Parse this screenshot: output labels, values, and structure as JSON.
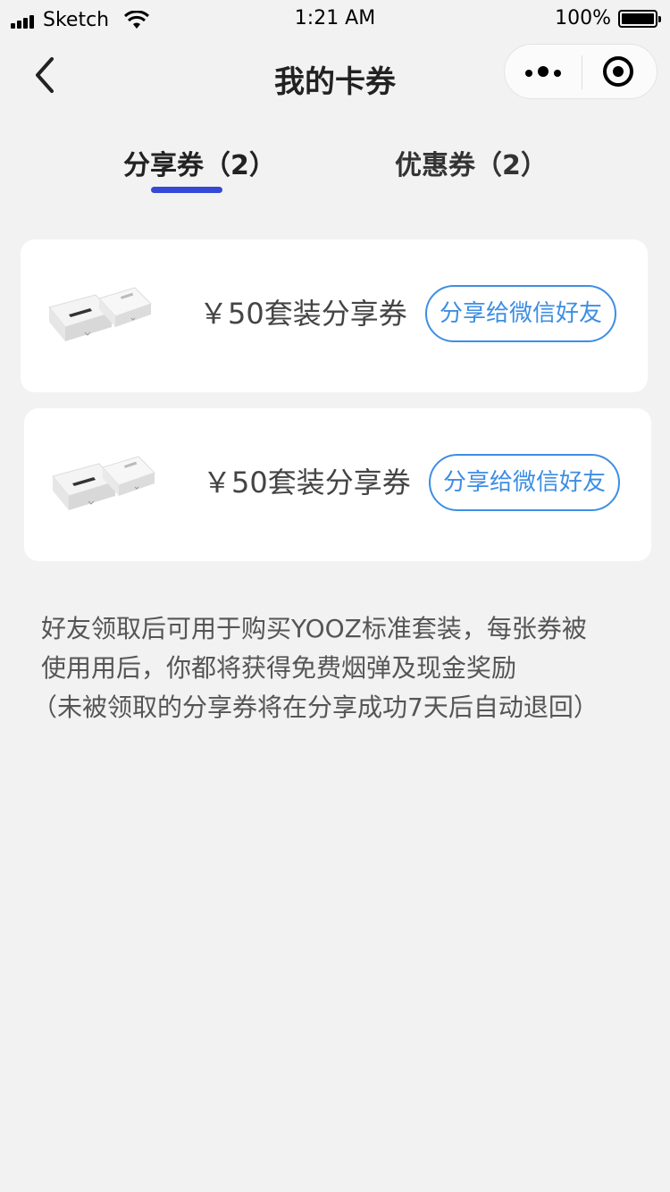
{
  "status_bar": {
    "carrier": "Sketch",
    "time": "1:21 AM",
    "battery": "100%"
  },
  "nav": {
    "title": "我的卡券"
  },
  "tabs": [
    {
      "label": "分享券（2）",
      "active": true
    },
    {
      "label": "优惠券（2）",
      "active": false
    }
  ],
  "colors": {
    "accent": "#3548d6",
    "button": "#3d8ee3",
    "background": "#f2f2f2"
  },
  "coupons": [
    {
      "title": "￥50套装分享券",
      "button_label": "分享给微信好友"
    },
    {
      "title": "￥50套装分享券",
      "button_label": "分享给微信好友"
    }
  ],
  "description": {
    "line1": "好友领取后可用于购买YOOZ标准套装，每张券被",
    "line2": "使用用后，你都将获得免费烟弹及现金奖励",
    "line3": "（未被领取的分享券将在分享成功7天后自动退回）"
  }
}
